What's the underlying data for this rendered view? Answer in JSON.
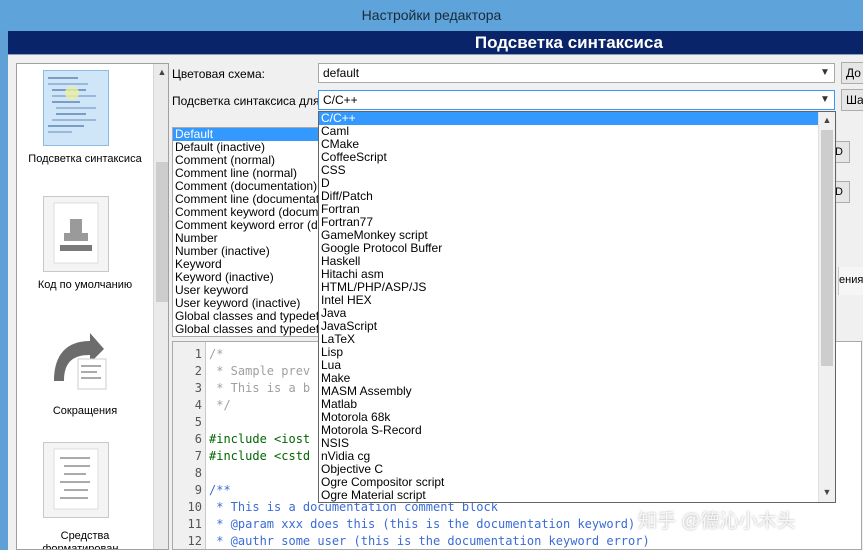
{
  "window": {
    "title": "Настройки редактора"
  },
  "header": {
    "title": "Подсветка синтаксиса"
  },
  "sidebar": {
    "items": [
      {
        "label": "Подсветка синтаксиса",
        "icon": "syntax-highlight-icon",
        "selected": true
      },
      {
        "label": "Код по умолчанию",
        "icon": "stamp-icon",
        "selected": false
      },
      {
        "label": "Сокращения",
        "icon": "abbreviation-arrow-icon",
        "selected": false
      },
      {
        "label": "Средства форматирован...",
        "icon": "formatter-icon",
        "selected": false
      }
    ]
  },
  "color_scheme": {
    "label": "Цветовая схема:",
    "value": "default",
    "side_button": "До"
  },
  "syntax_for": {
    "label": "Подсветка синтаксиса для:",
    "value": "C/C++",
    "side_button": "Ша"
  },
  "tokens": [
    "Default",
    "Default (inactive)",
    "Comment (normal)",
    "Comment line (normal)",
    "Comment (documentation)",
    "Comment line (documentation)",
    "Comment keyword (documentation)",
    "Comment keyword error (documentation)",
    "Number",
    "Number (inactive)",
    "Keyword",
    "Keyword (inactive)",
    "User keyword",
    "User keyword (inactive)",
    "Global classes and typedefs",
    "Global classes and typedefs (inactive)"
  ],
  "selected_token": "Default",
  "right_buttons": [
    "D",
    "D"
  ],
  "right_panel_fragment": "ения п",
  "languages": [
    "C/C++",
    "Caml",
    "CMake",
    "CoffeeScript",
    "CSS",
    "D",
    "Diff/Patch",
    "Fortran",
    "Fortran77",
    "GameMonkey script",
    "Google Protocol Buffer",
    "Haskell",
    "Hitachi asm",
    "HTML/PHP/ASP/JS",
    "Intel HEX",
    "Java",
    "JavaScript",
    "LaTeX",
    "Lisp",
    "Lua",
    "Make",
    "MASM Assembly",
    "Matlab",
    "Motorola 68k",
    "Motorola S-Record",
    "NSIS",
    "nVidia cg",
    "Objective C",
    "Ogre Compositor script",
    "Ogre Material script"
  ],
  "selected_language": "C/C++",
  "preview_lines": [
    {
      "num": "1",
      "text": "/*",
      "cls": "c-comment"
    },
    {
      "num": "2",
      "text": " * Sample prev",
      "cls": "c-comment"
    },
    {
      "num": "3",
      "text": " * This is a b",
      "cls": "c-comment"
    },
    {
      "num": "4",
      "text": " */",
      "cls": "c-comment"
    },
    {
      "num": "5",
      "text": "",
      "cls": ""
    },
    {
      "num": "6",
      "text": "#include <iost",
      "cls": "c-pre"
    },
    {
      "num": "7",
      "text": "#include <cstd",
      "cls": "c-pre"
    },
    {
      "num": "8",
      "text": "",
      "cls": ""
    },
    {
      "num": "9",
      "text": "/**",
      "cls": "c-doc"
    },
    {
      "num": "10",
      "text": " * This is a documentation comment block",
      "cls": "c-doc"
    },
    {
      "num": "11",
      "text": " * @param xxx does this (this is the documentation keyword)",
      "cls": "c-doc"
    },
    {
      "num": "12",
      "text": " * @authr some user (this is the documentation keyword error)",
      "cls": "c-doc"
    }
  ],
  "watermark": "知乎 @德沁小木头",
  "colors": {
    "header_bg": "#0a246a",
    "selection": "#3399ff",
    "titlebar": "#5ea3d9"
  }
}
